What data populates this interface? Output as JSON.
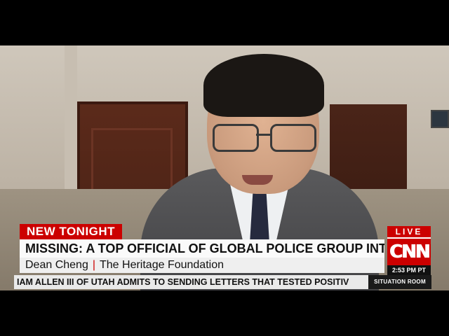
{
  "broadcast": {
    "tag": "NEW TONIGHT",
    "headline": "MISSING: A TOP OFFICIAL OF GLOBAL POLICE GROUP INTERPOLL",
    "guest_name": "Dean Cheng",
    "separator": "|",
    "guest_affiliation": "The Heritage Foundation",
    "live_label": "LIVE",
    "network_logo": "CNN",
    "time": "2:53 PM PT",
    "ticker": "IAM ALLEN III OF UTAH ADMITS TO SENDING LETTERS THAT TESTED POSITIV",
    "show_name": "SITUATION ROOM"
  },
  "colors": {
    "brand_red": "#cc0000",
    "headline_bg": "#fafafa",
    "ticker_bg": "#e9e9e9"
  }
}
